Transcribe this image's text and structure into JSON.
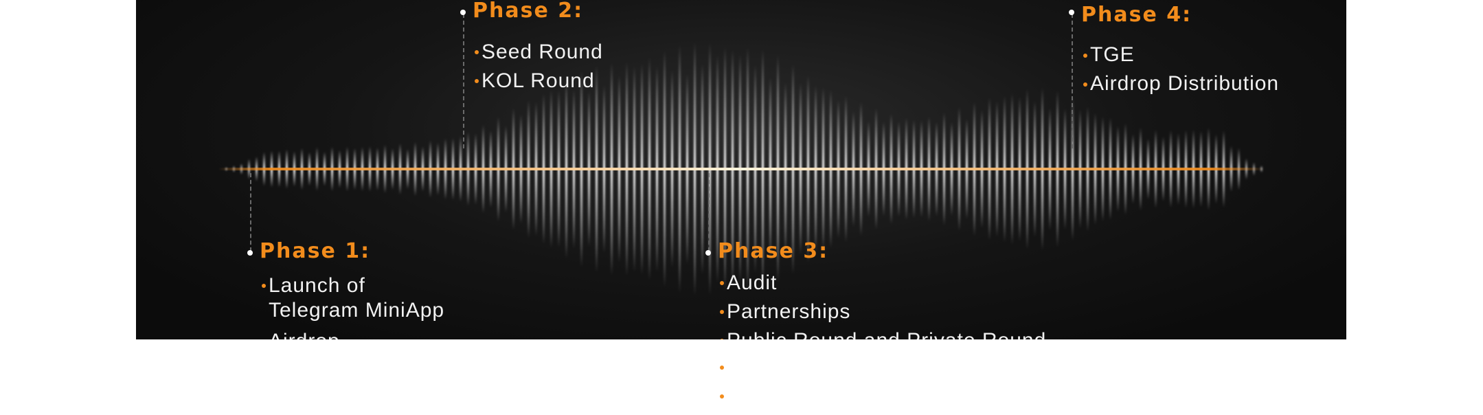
{
  "phases": [
    {
      "title": "Phase 1:",
      "items": [
        "Launch of",
        "Telegram MiniApp",
        "Airdrop"
      ]
    },
    {
      "title": "Phase 2:",
      "items": [
        "Seed Round",
        "KOL Round"
      ]
    },
    {
      "title": "Phase 3:",
      "items": [
        "Audit",
        "Partnerships",
        "Public Round and Private Round"
      ]
    },
    {
      "title": "Phase 4:",
      "items": [
        "TGE",
        "Airdrop Distribution"
      ]
    }
  ],
  "colors": {
    "accent": "#f28c1c",
    "background": "#111111",
    "text": "#f2f2f2",
    "wave": "#ffffff"
  }
}
